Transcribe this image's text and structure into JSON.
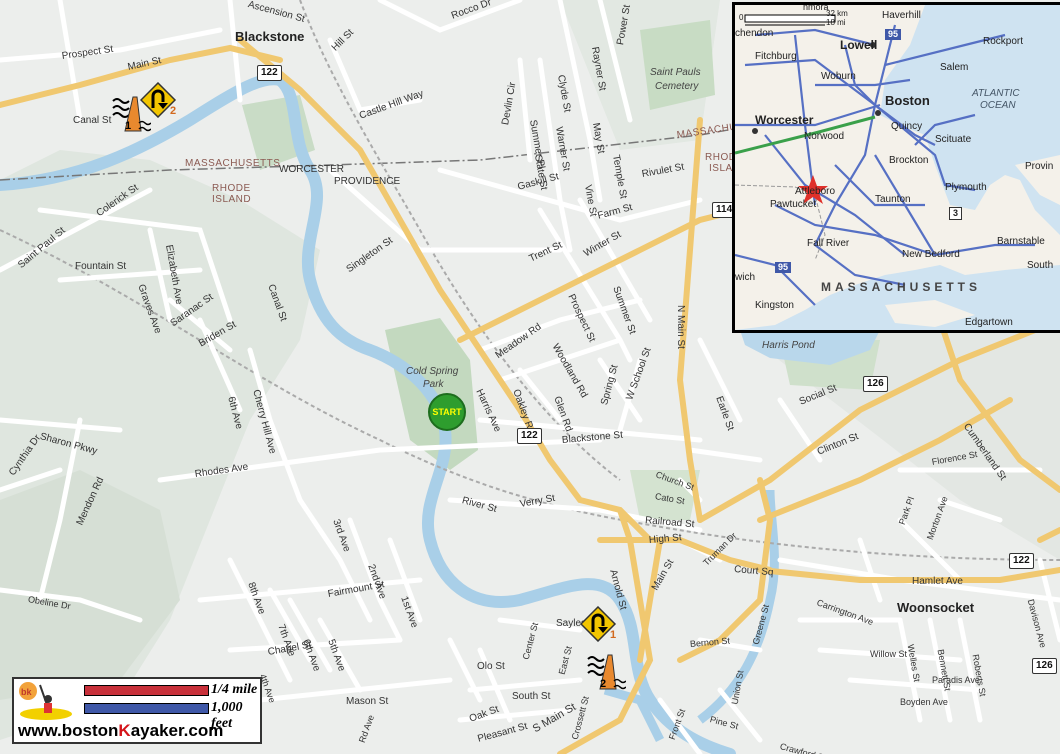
{
  "map": {
    "towns": {
      "blackstone": "Blackstone",
      "woonsocket": "Woonsocket"
    },
    "states": {
      "ma_label": "MASSACHUSETTS",
      "ri_label_1": "RHODE",
      "ri_label_2": "ISLAND",
      "ma_right": "MASSACHUSETTS",
      "ri_right_1": "RHODE",
      "ri_right_2": "ISLAND"
    },
    "border_labels": {
      "worcester": "WORCESTER",
      "providence": "PROVIDENCE"
    },
    "parks": {
      "cold_spring_1": "Cold Spring",
      "cold_spring_2": "Park",
      "cemetery_1": "Saint Pauls",
      "cemetery_2": "Cemetery",
      "harris_pond": "Harris Pond"
    },
    "streets": {
      "ascension": "Ascension St",
      "rocco": "Rocco Dr",
      "hill": "Hill St",
      "main": "Main St",
      "prospect_tl": "Prospect St",
      "canal_tl": "Canal St",
      "castle_hill": "Castle Hill Way",
      "rayner": "Rayner St",
      "power": "Power St",
      "clyde": "Clyde St",
      "devlin": "Devlin Cir",
      "summer_pl": "Summer Pl",
      "warner": "Warner St",
      "may": "May St",
      "temple": "Temple St",
      "state": "State St",
      "vine": "Vine St",
      "gaskill": "Gaskill St",
      "rivulet": "Rivulet St",
      "farm": "Farm St",
      "colerick": "Colerick St",
      "saint_paul": "Saint Paul St",
      "fountain": "Fountain St",
      "elizabeth": "Elizabeth Ave",
      "graves": "Graves Ave",
      "saranac": "Saranac St",
      "briden": "Briden St",
      "singleton": "Singleton St",
      "winter": "Winter St",
      "trent": "Trent St",
      "prospect_mid": "Prospect St",
      "summer": "Summer St",
      "n_main": "N Main St",
      "canal_mid": "Canal St",
      "harris": "Harris Ave",
      "meadow": "Meadow Rd",
      "woodland": "Woodland Rd",
      "oakley": "Oakley Rd",
      "glen": "Glen Rd",
      "spring": "Spring St",
      "w_school": "W School St",
      "earle": "Earle St",
      "sixth_ave_top": "6th Ave",
      "cherry_hill": "Cherry Hill Ave",
      "sharon": "Sharon Pkwy",
      "cynthia": "Cynthia Dr",
      "mendon": "Mendon Rd",
      "rhodes": "Rhodes Ave",
      "blackstone_st": "Blackstone St",
      "social": "Social St",
      "clinton": "Clinton St",
      "cumberland": "Cumberland St",
      "florence": "Florence St",
      "church": "Church St",
      "cato": "Cato St",
      "river": "River St",
      "verry": "Verry St",
      "railroad": "Railroad St",
      "high": "High St",
      "arnold": "Arnold St",
      "third_ave": "3rd Ave",
      "second_ave": "2nd Ave",
      "first_ave": "1st Ave",
      "eighth_ave": "8th Ave",
      "obeline": "Obeline Dr",
      "fairmount": "Fairmount St",
      "seventh_ave": "7th Ave",
      "fifth_ave": "5th Ave",
      "sixth_ave_bot": "6th Ave",
      "chapel": "Chapel St",
      "main_low": "Main St",
      "truman": "Truman Dr",
      "court_sq": "Court Sq",
      "hamlet": "Hamlet Ave",
      "carrington": "Carrington Ave",
      "park_pl": "Park Pl",
      "morton": "Morton Ave",
      "davison": "Davison Ave",
      "sayles": "Sayles St",
      "center": "Center St",
      "east": "East St",
      "olo": "Olo St",
      "south": "South St",
      "mason": "Mason St",
      "oak": "Oak St",
      "pleasant": "Pleasant St",
      "s_main": "S Main St",
      "bernon": "Bernon St",
      "greene": "Greene St",
      "union": "Union St",
      "willow": "Willow St",
      "welles": "Welles St",
      "bennett": "Bennett St",
      "roberts": "Roberts St",
      "paradis": "Paradis Ave",
      "pine": "Pine St",
      "boyden": "Boyden Ave",
      "crawford": "Crawford St",
      "front": "Front St",
      "crossett": "Crossett St",
      "fourth_ave": "4th Ave",
      "rd_ave": "Rd Ave"
    },
    "shields": {
      "r122_a": "122",
      "r122_b": "122",
      "r122_c": "122",
      "r126_a": "126",
      "r126_b": "126",
      "r114": "114"
    },
    "start_label": "START",
    "hazards": {
      "uturn_1_num": "2",
      "uturn_2_num": "1",
      "dam_1_num": "1",
      "dam_2_num": "2"
    }
  },
  "inset": {
    "scale_km": "32 km",
    "scale_mi": "18 mi",
    "scale_zero": "0",
    "cities": {
      "lowell": "Lowell",
      "boston": "Boston",
      "worcester": "Worcester",
      "haverhill": "Haverhill",
      "rockport": "Rockport",
      "salem": "Salem",
      "fitchburg": "Fitchburg",
      "woburn": "Woburn",
      "quincy": "Quincy",
      "norwood": "Norwood",
      "scituate": "Scituate",
      "brockton": "Brockton",
      "attleboro": "Attleboro",
      "pawtucket": "Pawtucket",
      "taunton": "Taunton",
      "plymouth": "Plymouth",
      "fall_river": "Fall River",
      "new_bedford": "New Bedford",
      "barnstable": "Barnstable",
      "south": "South",
      "kingston": "Kingston",
      "edgartown": "Edgartown",
      "provin": "Provin",
      "wich": "wich",
      "chendon": "chendon",
      "nmora": "nmora"
    },
    "ocean_1": "ATLANTIC",
    "ocean_2": "OCEAN",
    "state": "MASSACHUSETTS",
    "shields": {
      "i95_n": "95",
      "i95_s": "95",
      "r3": "3"
    }
  },
  "legend": {
    "quarter_mile_num": "1/4",
    "quarter_mile_unit": "mile",
    "feet": "1,000 feet",
    "website_pre": "www.boston",
    "website_k": "K",
    "website_post": "ayaker.com",
    "logo_text": "bk"
  },
  "colors": {
    "river": "#a9cfe8",
    "major_road": "#f0c870",
    "minor_road": "#ffffff",
    "park": "#c8dcc4",
    "start": "#2e9d2e",
    "sign": "#f2c500",
    "scale_red": "#c8303a",
    "scale_blue": "#3f58a8",
    "inset_water": "#cfe3f1",
    "inset_road": "#5670c4"
  }
}
